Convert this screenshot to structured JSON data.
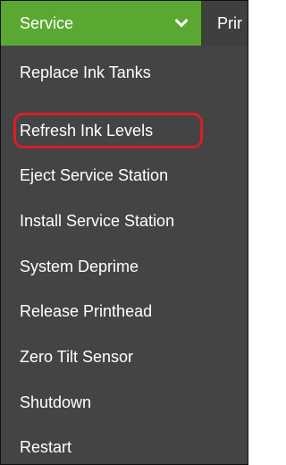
{
  "menubar": {
    "active_tab": "Service",
    "next_tab": "Prir"
  },
  "service_menu": {
    "items": [
      {
        "label": "Replace Ink Tanks"
      },
      {
        "label": "Refresh Ink Levels",
        "highlighted": true
      },
      {
        "label": "Eject Service Station"
      },
      {
        "label": "Install Service Station"
      },
      {
        "label": "System Deprime"
      },
      {
        "label": "Release Printhead"
      },
      {
        "label": "Zero Tilt Sensor"
      },
      {
        "label": "Shutdown"
      },
      {
        "label": "Restart"
      }
    ]
  },
  "colors": {
    "menu_background": "#444444",
    "active_tab": "#5aa832",
    "highlight_ring": "#d91f26",
    "text": "#ffffff"
  },
  "icons": {
    "dropdown_chevron": "chevron-down-icon"
  }
}
